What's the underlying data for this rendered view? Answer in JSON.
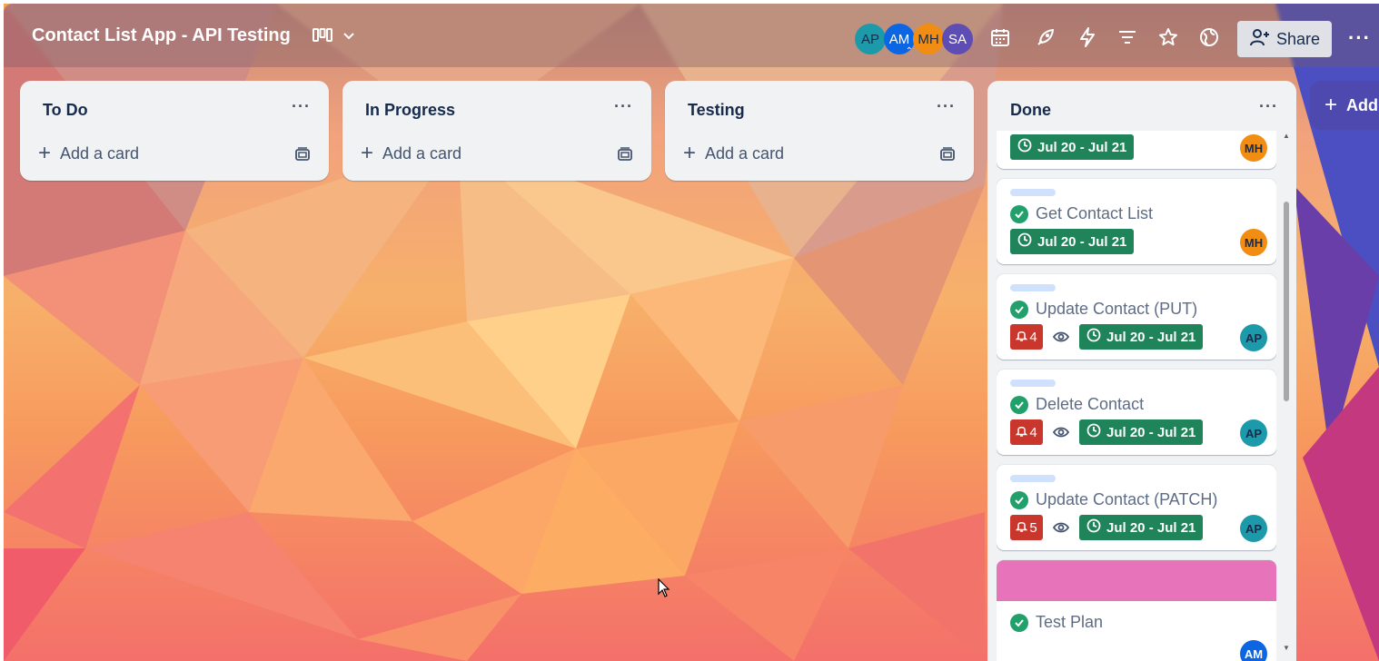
{
  "board": {
    "title": "Contact List App - API Testing",
    "share_label": "Share"
  },
  "members": [
    {
      "initials": "AP",
      "color": "#1d9aaa"
    },
    {
      "initials": "AM",
      "color": "#0c66e4"
    },
    {
      "initials": "MH",
      "color": "#f18d13"
    },
    {
      "initials": "SA",
      "color": "#5e4db2"
    }
  ],
  "lists": [
    {
      "title": "To Do",
      "add_label": "Add a card"
    },
    {
      "title": "In Progress",
      "add_label": "Add a card"
    },
    {
      "title": "Testing",
      "add_label": "Add a card"
    }
  ],
  "done": {
    "title": "Done",
    "cards": [
      {
        "title": "",
        "date": "Jul 20 - Jul 21",
        "member": "MH"
      },
      {
        "title": "Get Contact List",
        "date": "Jul 20 - Jul 21",
        "member": "MH"
      },
      {
        "title": "Update Contact (PUT)",
        "date": "Jul 20 - Jul 21",
        "member": "AP",
        "notifications": "4"
      },
      {
        "title": "Delete Contact",
        "date": "Jul 20 - Jul 21",
        "member": "AP",
        "notifications": "4"
      },
      {
        "title": "Update Contact (PATCH)",
        "date": "Jul 20 - Jul 21",
        "member": "AP",
        "notifications": "5"
      },
      {
        "title": "Test Plan",
        "cover_color": "#e774bb",
        "member": "AM"
      }
    ]
  },
  "add_list_label": "Add"
}
